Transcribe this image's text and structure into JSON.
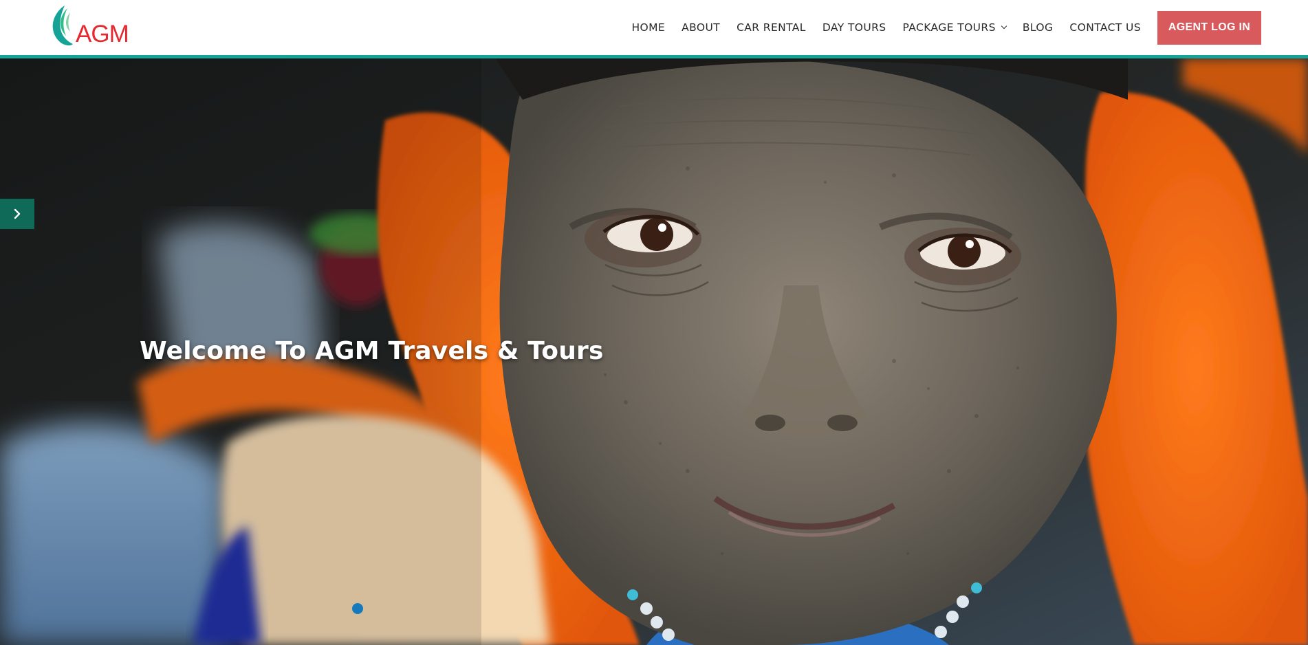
{
  "brand": {
    "logo_text": "AGM"
  },
  "nav": {
    "items": [
      {
        "label": "HOME"
      },
      {
        "label": "ABOUT"
      },
      {
        "label": "CAR RENTAL"
      },
      {
        "label": "DAY TOURS"
      },
      {
        "label": "PACKAGE TOURS",
        "has_dropdown": true
      },
      {
        "label": "BLOG"
      },
      {
        "label": "CONTACT US"
      }
    ],
    "login_label": "AGENT LOG IN"
  },
  "hero": {
    "title": "Welcome To AGM Travels & Tours",
    "next_icon": "chevron-right-icon"
  },
  "colors": {
    "accent_line": "#14a397",
    "logo_red": "#e42a30",
    "logo_green": "#14a397",
    "login_button": "#d85a5c",
    "slider_arrow_bg": "#0f6b57"
  }
}
